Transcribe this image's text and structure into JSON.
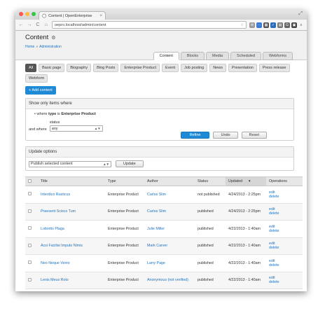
{
  "browser": {
    "tab_title": "Content | OpenEnterprise",
    "url": "oepro.localhost/admin/content"
  },
  "page": {
    "title": "Content",
    "breadcrumb": [
      "Home",
      "Administration"
    ],
    "primary_tabs": [
      {
        "label": "Content",
        "active": true
      },
      {
        "label": "Blocks"
      },
      {
        "label": "Media"
      },
      {
        "label": "Scheduled"
      },
      {
        "label": "Webforms"
      }
    ]
  },
  "type_filters": [
    "All",
    "Basic page",
    "Biography",
    "Blog Posts",
    "Enterprise Product",
    "Event",
    "Job posting",
    "News",
    "Presentation",
    "Press release",
    "Webform"
  ],
  "add_content": "+ Add content",
  "filter": {
    "legend": "Show only items where",
    "where_prefix": "where",
    "where_field": "type",
    "where_op": "is",
    "where_value": "Enterprise Product",
    "and_where": "and where",
    "status_label": "status",
    "status_value": "any",
    "refine": "Refine",
    "undo": "Undo",
    "reset": "Reset"
  },
  "update": {
    "legend": "Update options",
    "option": "Publish selected content",
    "button": "Update"
  },
  "table": {
    "headers": {
      "title": "Title",
      "type": "Type",
      "author": "Author",
      "status": "Status",
      "updated": "Updated",
      "operations": "Operations"
    },
    "rows": [
      {
        "title": "Interdico Rusticus",
        "type": "Enterprise Product",
        "author": "Carlos Slim",
        "status": "not published",
        "updated": "4/24/2013 - 2:25pm"
      },
      {
        "title": "Praesent Scisco Tum",
        "type": "Enterprise Product",
        "author": "Carlos Slim",
        "status": "published",
        "updated": "4/24/2013 - 2:25pm"
      },
      {
        "title": "Lobortis Plaga",
        "type": "Enterprise Product",
        "author": "Julie Miller",
        "status": "published",
        "updated": "4/22/2013 - 1:40am"
      },
      {
        "title": "Acsi Facilisi Imputo Nimis",
        "type": "Enterprise Product",
        "author": "Mark Carver",
        "status": "published",
        "updated": "4/22/2013 - 1:40am"
      },
      {
        "title": "Neo Neque Venio",
        "type": "Enterprise Product",
        "author": "Larry Page",
        "status": "published",
        "updated": "4/22/2013 - 1:40am"
      },
      {
        "title": "Lenis Meus Roto",
        "type": "Enterprise Product",
        "author": "Anonymous (not verified)",
        "status": "published",
        "updated": "4/22/2013 - 1:40am"
      }
    ],
    "op_edit": "edit",
    "op_delete": "delete"
  }
}
